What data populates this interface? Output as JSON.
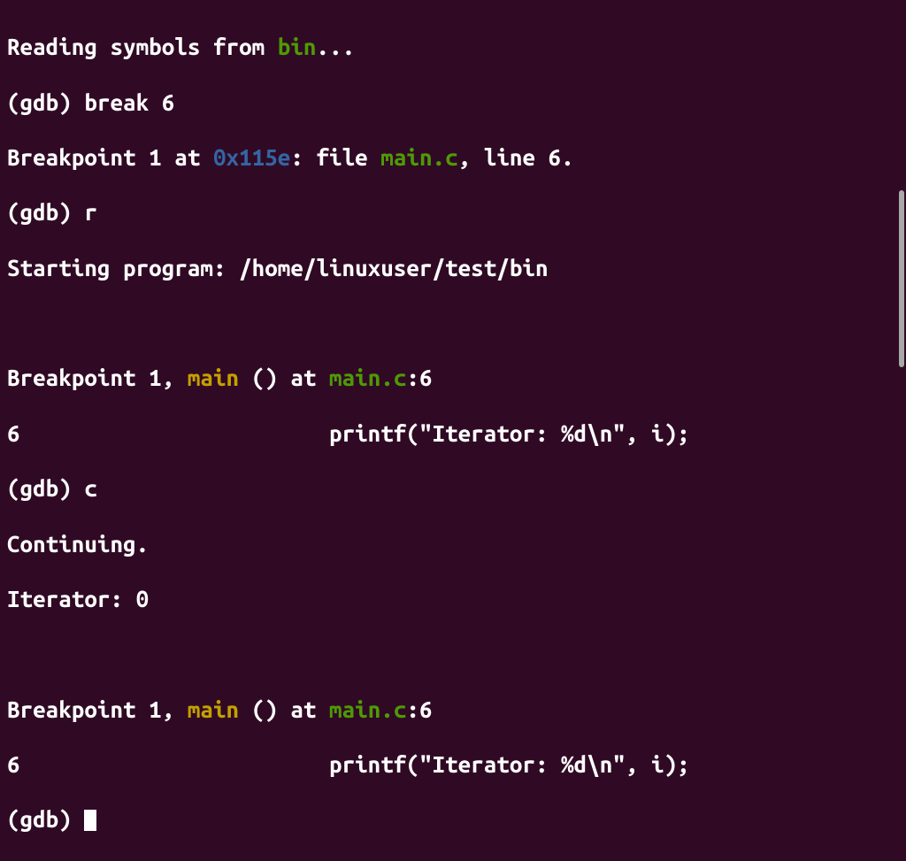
{
  "colors": {
    "background": "#300a24",
    "text": "#ffffff",
    "green": "#4e9a06",
    "blue": "#3465a4",
    "yellow": "#c4a000",
    "cyan": "#06989a"
  },
  "session": {
    "reading_prefix": "Reading symbols from ",
    "bin_name": "bin",
    "reading_suffix": "...",
    "prompt": "(gdb) ",
    "cmd_break": "break 6",
    "bp_set_prefix": "Breakpoint 1 at ",
    "bp_address": "0x115e",
    "bp_file_prefix": ": file ",
    "bp_file": "main.c",
    "bp_line_suffix": ", line 6.",
    "cmd_run": "r",
    "starting_text": "Starting program: /home/linuxuser/test/bin",
    "blank": "",
    "bp_hit_prefix": "Breakpoint 1, ",
    "bp_func": "main",
    "bp_paren": " () at ",
    "bp_location": "main.c",
    "bp_colon": ":6",
    "src_line_num": "6",
    "src_line_text": "                        printf(\"Iterator: %d\\n\", i);",
    "cmd_continue": "c",
    "continuing_text": "Continuing.",
    "output_text": "Iterator: 0"
  }
}
